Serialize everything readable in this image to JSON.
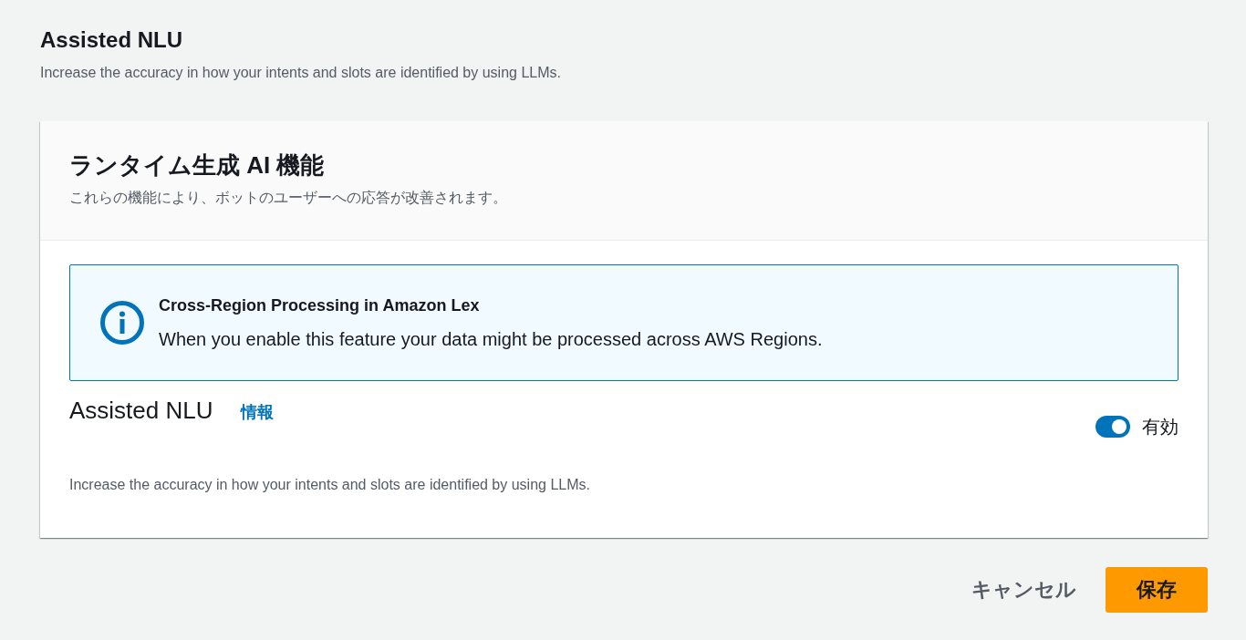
{
  "section": {
    "title": "Assisted NLU",
    "description": "Increase the accuracy in how your intents and slots are identified by using LLMs."
  },
  "card": {
    "title": "ランタイム生成 AI 機能",
    "subtitle": "これらの機能により、ボットのユーザーへの応答が改善されます。",
    "alert": {
      "kind": "info",
      "title": "Cross-Region Processing in Amazon Lex",
      "message": "When you enable this feature your data might be processed across AWS Regions."
    },
    "setting": {
      "label": "Assisted NLU",
      "info_link": "情報",
      "toggle": {
        "on": true,
        "label": "有効"
      },
      "description": "Increase the accuracy in how your intents and slots are identified by using LLMs."
    }
  },
  "buttons": [
    {
      "label": "キャンセル",
      "kind": "link"
    },
    {
      "label": "保存",
      "kind": "primary"
    }
  ]
}
